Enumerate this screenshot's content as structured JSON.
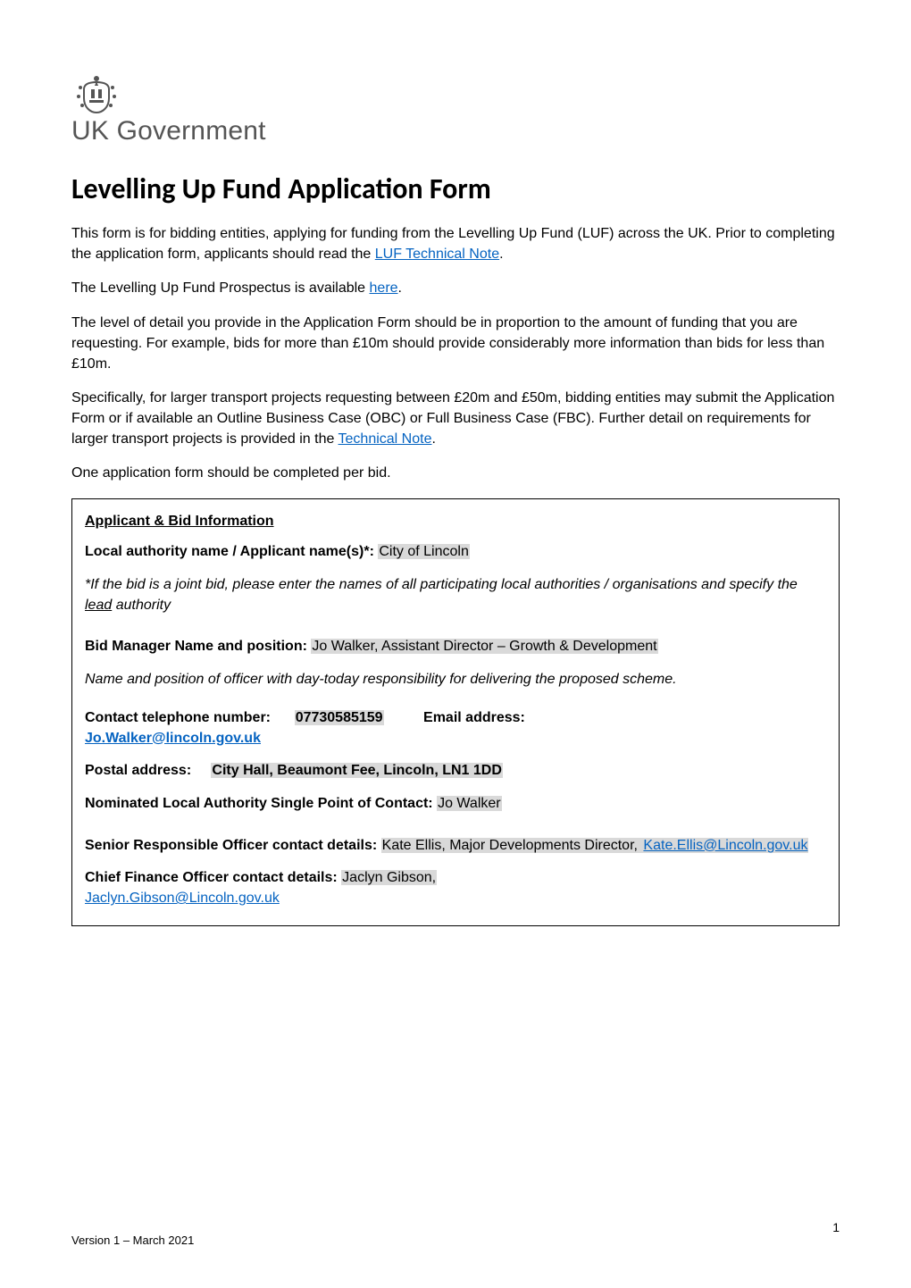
{
  "logo": {
    "crest_name": "uk-royal-crest-icon",
    "brand_text": "UK Government"
  },
  "title": "Levelling Up Fund Application Form",
  "intro": {
    "p1_pre": "This form is for bidding entities, applying for funding from the Levelling Up Fund (LUF) across the UK. Prior to completing the application form, applicants should read the ",
    "p1_link": "LUF Technical Note",
    "p1_post": ".",
    "p2_pre": "The Levelling Up Fund Prospectus is available ",
    "p2_link": "here",
    "p2_post": ".",
    "p3": "The level of detail you provide in the Application Form should be in proportion to the amount of funding that you are requesting. For example, bids for more than £10m should provide considerably more information than bids for less than £10m.",
    "p4_pre": "Specifically, for larger transport projects requesting between £20m and £50m, bidding entities may submit the Application Form or if available an Outline Business Case (OBC) or Full Business Case (FBC).  Further detail on requirements for larger transport projects is provided in the ",
    "p4_link": "Technical Note",
    "p4_post": ".",
    "p5": "One application form should be completed per bid."
  },
  "box": {
    "heading": "Applicant & Bid Information",
    "local_authority_label": "Local authority name / Applicant name(s)*: ",
    "local_authority_value": "City of Lincoln",
    "joint_bid_note_pre": "*If the bid is a joint bid, please enter the names of all participating local authorities  / organisations and specify the ",
    "joint_bid_note_underline": "lead",
    "joint_bid_note_post": " authority",
    "bid_manager_label": "Bid Manager Name and position: ",
    "bid_manager_value": "Jo Walker, Assistant Director – Growth & Development",
    "bid_manager_note": "Name and position of officer with day-today responsibility for delivering the proposed scheme.",
    "contact_tel_label": "Contact telephone number:",
    "contact_tel_value": "07730585159",
    "email_label": "Email address:",
    "email_value": "Jo.Walker@lincoln.gov.uk",
    "postal_label": "Postal address:",
    "postal_value": "City Hall, Beaumont Fee, Lincoln, LN1 1DD",
    "spoc_label": "Nominated Local Authority Single Point of Contact:  ",
    "spoc_value": "Jo Walker",
    "sro_label": "Senior Responsible Officer contact details: ",
    "sro_value_text": "Kate Ellis, Major Developments Director, ",
    "sro_value_email": "Kate.Ellis@Lincoln.gov.uk",
    "cfo_label": "Chief Finance Officer contact details: ",
    "cfo_value_text": "Jaclyn Gibson,",
    "cfo_value_email": "Jaclyn.Gibson@Lincoln.gov.uk"
  },
  "footer": {
    "version": "Version 1 – March 2021",
    "page_number": "1"
  }
}
